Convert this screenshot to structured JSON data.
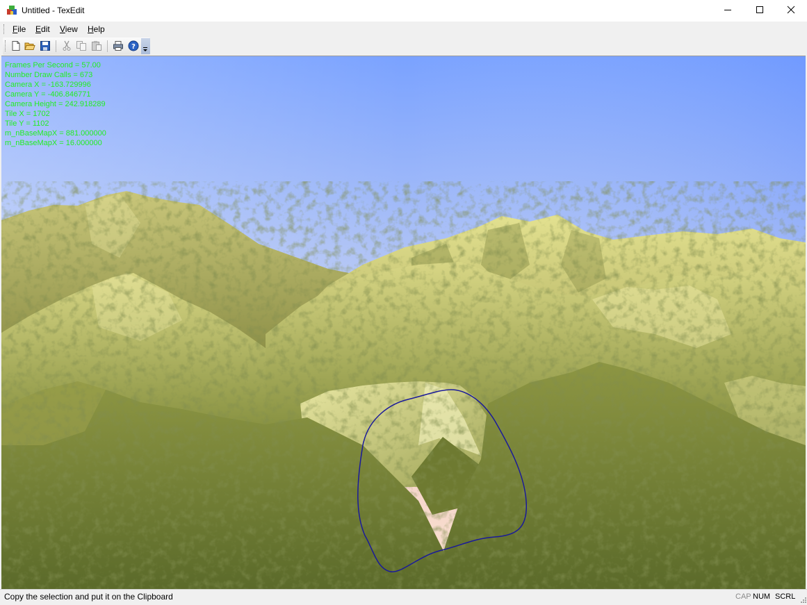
{
  "window": {
    "title": "Untitled - TexEdit",
    "app_icon": "texedit-app-icon",
    "controls": [
      "minimize-icon",
      "maximize-icon",
      "close-icon"
    ]
  },
  "menu": {
    "items": [
      {
        "mnemonic": "F",
        "rest": "ile"
      },
      {
        "mnemonic": "E",
        "rest": "dit"
      },
      {
        "mnemonic": "V",
        "rest": "iew"
      },
      {
        "mnemonic": "H",
        "rest": "elp"
      }
    ]
  },
  "toolbar": {
    "buttons": [
      "new-icon",
      "open-icon",
      "save-icon",
      "cut-icon",
      "copy-icon",
      "paste-icon",
      "print-icon",
      "help-icon"
    ]
  },
  "overlay": {
    "lines": [
      "Frames Per Second = 57.00",
      "Number Draw Calls = 673",
      "Camera X = -163.729996",
      "Camera Y = -406.846771",
      "Camera Height = 242.918289",
      "Tile X = 1702",
      "Tile Y = 1102",
      "m_nBaseMapX = 881.000000",
      "m_nBaseMapX = 16.000000"
    ],
    "color": "#22ee22"
  },
  "status": {
    "message": "Copy the selection and put it on the Clipboard",
    "indicators": [
      "CAP",
      "NUM",
      "SCRL"
    ]
  },
  "colors": {
    "sky_top": "#7aa2ff",
    "sky_horizon": "#fbd9c9",
    "terrain_light": "#d9d98a",
    "terrain_dark": "#5e6b2a",
    "selection_outline": "#1a1a9a"
  }
}
